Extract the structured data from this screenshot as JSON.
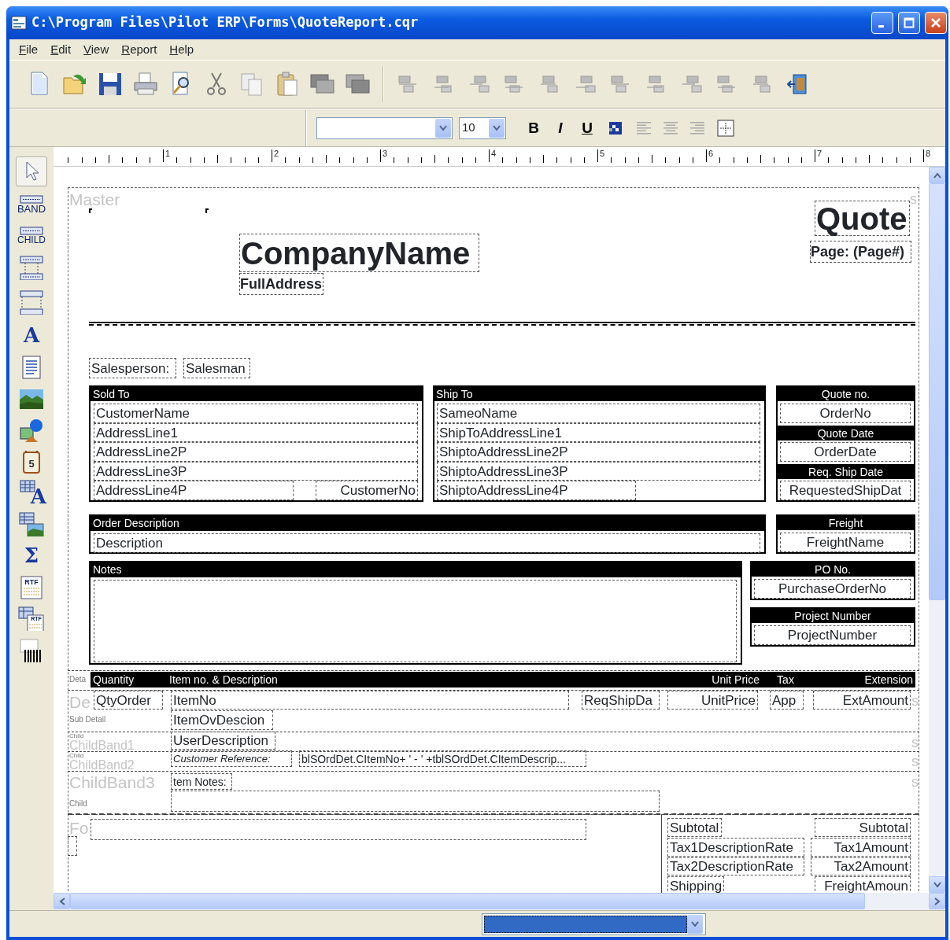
{
  "window": {
    "title": "C:\\Program Files\\Pilot ERP\\Forms\\QuoteReport.cqr"
  },
  "menu": [
    "File",
    "Edit",
    "View",
    "Report",
    "Help"
  ],
  "format_bar": {
    "font_size": "10",
    "bold": "B",
    "italic": "I",
    "underline": "U"
  },
  "ruler": [
    "1",
    "2",
    "3",
    "4",
    "5",
    "6",
    "7",
    "8"
  ],
  "palette": [
    {
      "kind": "pointer",
      "selected": true
    },
    {
      "kind": "band",
      "caption": "BAND",
      "selected": false
    },
    {
      "kind": "band",
      "caption": "CHILD",
      "selected": false
    },
    {
      "kind": "group",
      "selected": false
    },
    {
      "kind": "subdetail",
      "selected": false
    },
    {
      "kind": "glyph",
      "caption": "A",
      "selected": false
    },
    {
      "kind": "memo",
      "selected": false
    },
    {
      "kind": "image",
      "selected": false
    },
    {
      "kind": "shape",
      "selected": false
    },
    {
      "kind": "calendar",
      "caption": "5",
      "selected": false
    },
    {
      "kind": "dbglyph",
      "caption": "A",
      "selected": false
    },
    {
      "kind": "dbimage",
      "selected": false
    },
    {
      "kind": "glyph",
      "caption": "Σ",
      "selected": false
    },
    {
      "kind": "rtf",
      "caption": "RTF",
      "selected": false
    },
    {
      "kind": "dbrtf",
      "caption": "RTF",
      "selected": false
    },
    {
      "kind": "barcode",
      "selected": false
    }
  ],
  "report_items": [
    {
      "kind": "band-name",
      "text": "Master"
    },
    {
      "kind": "band-mark",
      "text": "s"
    },
    {
      "kind": "title",
      "text": "Quote"
    },
    {
      "kind": "title",
      "text": "CompanyName"
    },
    {
      "kind": "subtitle",
      "text": "Page: (Page#)"
    },
    {
      "kind": "subtitle",
      "text": "FullAddress"
    },
    {
      "kind": "field",
      "text": "Salesperson:"
    },
    {
      "kind": "field",
      "text": "Salesman"
    },
    {
      "kind": "bar",
      "text": "Sold To"
    },
    {
      "kind": "field",
      "text": "CustomerName"
    },
    {
      "kind": "field",
      "text": "AddressLine1"
    },
    {
      "kind": "field",
      "text": "AddressLine2P"
    },
    {
      "kind": "field",
      "text": "AddressLine3P"
    },
    {
      "kind": "field",
      "text": "AddressLine4P"
    },
    {
      "kind": "field-right",
      "text": "CustomerNo"
    },
    {
      "kind": "bar",
      "text": "Ship To"
    },
    {
      "kind": "field",
      "text": "SameoName"
    },
    {
      "kind": "field",
      "text": "ShipToAddressLine1"
    },
    {
      "kind": "field",
      "text": "ShiptoAddressLine2P"
    },
    {
      "kind": "field",
      "text": "ShiptoAddressLine3P"
    },
    {
      "kind": "field",
      "text": "ShiptoAddressLine4P"
    },
    {
      "kind": "bar-center",
      "text": "Quote no."
    },
    {
      "kind": "field-center",
      "text": "OrderNo"
    },
    {
      "kind": "bar-center",
      "text": "Quote Date"
    },
    {
      "kind": "field-center",
      "text": "OrderDate"
    },
    {
      "kind": "bar-center",
      "text": "Req. Ship Date"
    },
    {
      "kind": "field-center",
      "text": "RequestedShipDat"
    },
    {
      "kind": "bar",
      "text": "Order Description"
    },
    {
      "kind": "field",
      "text": "Description"
    },
    {
      "kind": "bar-center",
      "text": "Freight"
    },
    {
      "kind": "field-center",
      "text": "FreightName"
    },
    {
      "kind": "bar",
      "text": "Notes"
    },
    {
      "kind": "empty-field"
    },
    {
      "kind": "bar-center",
      "text": "PO No."
    },
    {
      "kind": "field-center",
      "text": "PurchaseOrderNo"
    },
    {
      "kind": "bar-center",
      "text": "Project Number"
    },
    {
      "kind": "field-center",
      "text": "ProjectNumber"
    },
    {
      "kind": "band-tag",
      "text": "Deta"
    },
    {
      "kind": "bar",
      "text": "Quantity"
    },
    {
      "kind": "bar",
      "text": "Item no. & Description"
    },
    {
      "kind": "bar-right",
      "text": "Unit Price"
    },
    {
      "kind": "bar-center",
      "text": "Tax"
    },
    {
      "kind": "bar-right",
      "text": "Extension"
    },
    {
      "kind": "band-name",
      "text": "De"
    },
    {
      "kind": "field",
      "text": "QtyOrder"
    },
    {
      "kind": "field",
      "text": "ItemNo"
    },
    {
      "kind": "field",
      "text": "ReqShipDa"
    },
    {
      "kind": "field-right",
      "text": "UnitPrice"
    },
    {
      "kind": "field",
      "text": "App"
    },
    {
      "kind": "field-right",
      "text": "ExtAmount"
    },
    {
      "kind": "band-mark",
      "text": "s"
    },
    {
      "kind": "band-tag",
      "text": "Sub Detail"
    },
    {
      "kind": "field",
      "text": "ItemOvDescion"
    },
    {
      "kind": "band-tag",
      "text": "Child"
    },
    {
      "kind": "band-name",
      "text": "ChildBand1"
    },
    {
      "kind": "field",
      "text": "UserDescription"
    },
    {
      "kind": "band-mark",
      "text": "s"
    },
    {
      "kind": "band-tag",
      "text": "Child"
    },
    {
      "kind": "band-name",
      "text": "ChildBand2"
    },
    {
      "kind": "italic-field",
      "text": "Customer Reference:"
    },
    {
      "kind": "small-field",
      "text": "blSOrdDet.CItemNo+ ' - ' +tblSOrdDet.CItemDescrip..."
    },
    {
      "kind": "band-mark",
      "text": "s"
    },
    {
      "kind": "band-name",
      "text": "ChildBand3"
    },
    {
      "kind": "small-field",
      "text": "tem Notes:"
    },
    {
      "kind": "band-mark",
      "text": "s"
    },
    {
      "kind": "empty-field"
    },
    {
      "kind": "band-tag",
      "text": "Child"
    },
    {
      "kind": "band-name",
      "text": "Fo"
    },
    {
      "kind": "empty-field"
    },
    {
      "kind": "empty-field"
    },
    {
      "kind": "field",
      "text": "Subtotal"
    },
    {
      "kind": "field-right",
      "text": "Subtotal"
    },
    {
      "kind": "field",
      "text": "Tax1DescriptionRate"
    },
    {
      "kind": "field-right",
      "text": "Tax1Amount"
    },
    {
      "kind": "field",
      "text": "Tax2DescriptionRate"
    },
    {
      "kind": "field-right",
      "text": "Tax2Amount"
    },
    {
      "kind": "field",
      "text": "Shipping"
    },
    {
      "kind": "field-right",
      "text": "FreightAmoun"
    }
  ]
}
